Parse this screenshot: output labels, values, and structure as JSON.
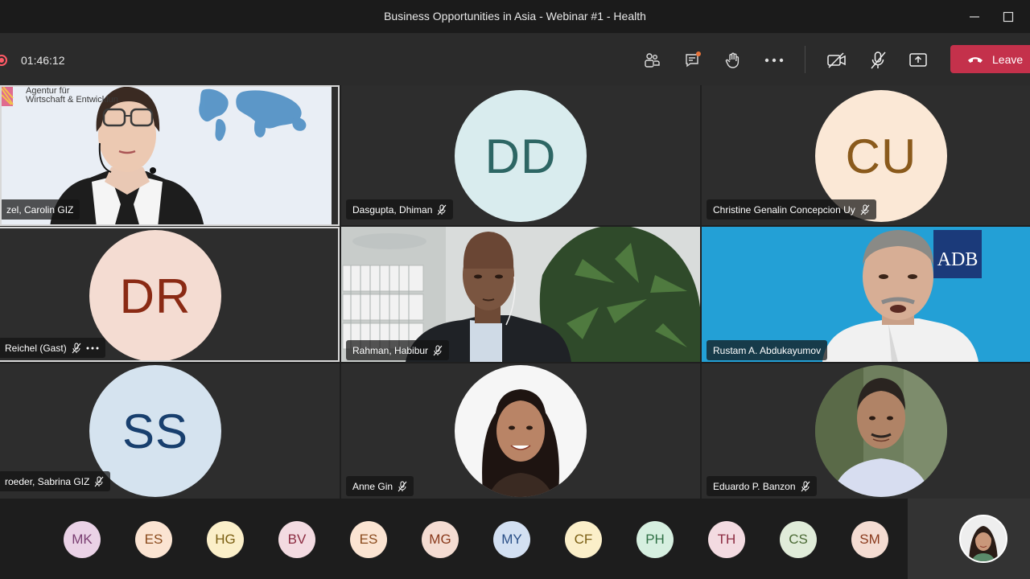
{
  "window": {
    "title": "Business Opportunities in Asia - Webinar #1 - Health"
  },
  "toolbar": {
    "timer": "01:46:12",
    "leave_label": "Leave"
  },
  "tiles": [
    {
      "name": "zel, Carolin GIZ",
      "logo_text_1": "Agentur für",
      "logo_text_2": "Wirtschaft & Entwicklun"
    },
    {
      "name": "Dasgupta, Dhiman",
      "initials": "DD",
      "bg": "#d9ecee",
      "fg": "#2d6664"
    },
    {
      "name": "Christine Genalin Concepcion Uy",
      "initials": "CU",
      "bg": "#fbe8d6",
      "fg": "#8a5a1c"
    },
    {
      "name": "Reichel (Gast)",
      "initials": "DR",
      "bg": "#f4dcd2",
      "fg": "#8a2a14"
    },
    {
      "name": "Rahman, Habibur"
    },
    {
      "name": "Rustam A. Abdukayumov",
      "logo": "ADB"
    },
    {
      "name": "roeder, Sabrina GIZ",
      "initials": "SS",
      "bg": "#d5e3ef",
      "fg": "#183f6e"
    },
    {
      "name": "Anne Gin"
    },
    {
      "name": "Eduardo P. Banzon"
    }
  ],
  "tray": [
    {
      "initials": "MK",
      "bg": "#ead2e6",
      "fg": "#7a3f72"
    },
    {
      "initials": "ES",
      "bg": "#fbe4d2",
      "fg": "#8a4a1c"
    },
    {
      "initials": "HG",
      "bg": "#fbefc9",
      "fg": "#7a5e12"
    },
    {
      "initials": "BV",
      "bg": "#f3dbe1",
      "fg": "#8b2b40"
    },
    {
      "initials": "ES",
      "bg": "#fbe4d2",
      "fg": "#8a4a1c"
    },
    {
      "initials": "MG",
      "bg": "#f4dcd2",
      "fg": "#8a3a1c"
    },
    {
      "initials": "MY",
      "bg": "#d3e0f2",
      "fg": "#2a4f87"
    },
    {
      "initials": "CF",
      "bg": "#fbefc9",
      "fg": "#7a5e12"
    },
    {
      "initials": "PH",
      "bg": "#d6efe0",
      "fg": "#2f6f45"
    },
    {
      "initials": "TH",
      "bg": "#f3dbe1",
      "fg": "#8b2b40"
    },
    {
      "initials": "CS",
      "bg": "#e0ecd9",
      "fg": "#4a6a34"
    },
    {
      "initials": "SM",
      "bg": "#f4dcd2",
      "fg": "#8a3a1c"
    }
  ],
  "colors": {
    "leave": "#c4314b",
    "notification_dot": "#e8733a"
  },
  "icons": [
    "record-icon",
    "participants-icon",
    "chat-icon",
    "raise-hand-icon",
    "more-icon",
    "camera-off-icon",
    "mic-off-icon",
    "share-screen-icon",
    "phone-hangup-icon",
    "minimize-icon",
    "maximize-icon"
  ]
}
